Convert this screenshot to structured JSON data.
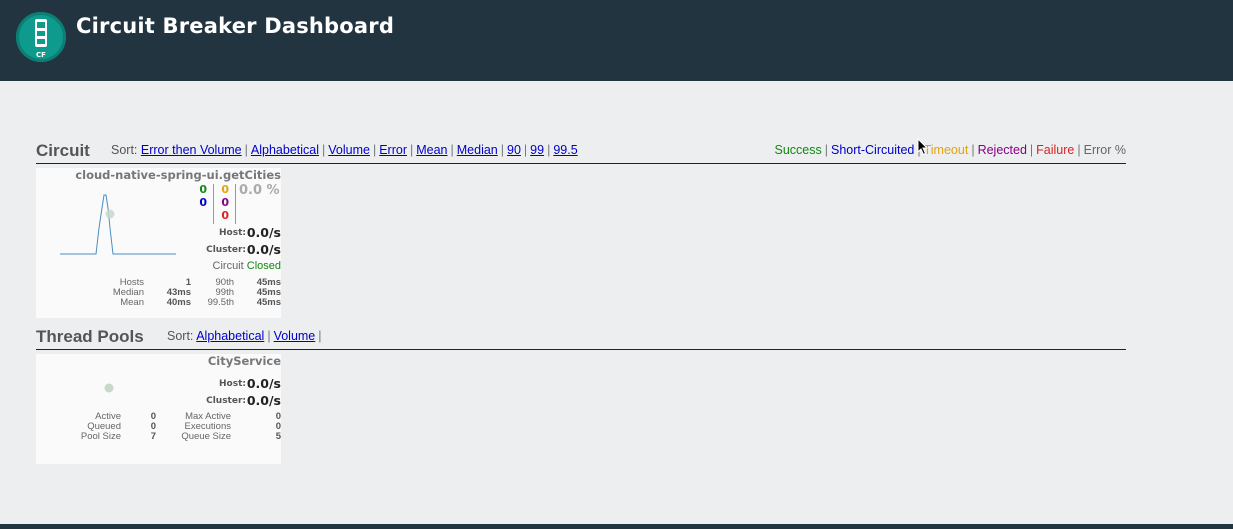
{
  "header": {
    "title": "Circuit Breaker Dashboard",
    "logo_text": "CF"
  },
  "circuit_section": {
    "title": "Circuit",
    "sort_label": "Sort:",
    "sort_options": [
      "Error then Volume",
      "Alphabetical",
      "Volume",
      "Error",
      "Mean",
      "Median",
      "90",
      "99",
      "99.5"
    ],
    "legend": [
      {
        "label": "Success",
        "color": "#118811"
      },
      {
        "label": "Short-Circuited",
        "color": "#0000cc"
      },
      {
        "label": "Timeout",
        "color": "#e8a30c"
      },
      {
        "label": "Rejected",
        "color": "#880088"
      },
      {
        "label": "Failure",
        "color": "#dd2222"
      },
      {
        "label": "Error %",
        "color": "#666666"
      }
    ]
  },
  "circuit_card": {
    "name": "cloud-native-spring-ui.getCities",
    "counts": {
      "success": "0",
      "short_circuited": "0",
      "timeout": "0",
      "rejected": "0",
      "failure": "0"
    },
    "error_pct": "0.0 %",
    "host_label": "Host:",
    "host_rate": "0.0/s",
    "cluster_label": "Cluster:",
    "cluster_rate": "0.0/s",
    "circuit_label": "Circuit",
    "circuit_status": "Closed",
    "stats": {
      "hosts_label": "Hosts",
      "hosts": "1",
      "median_label": "Median",
      "median": "43ms",
      "mean_label": "Mean",
      "mean": "40ms",
      "p90_label": "90th",
      "p90": "45ms",
      "p99_label": "99th",
      "p99": "45ms",
      "p995_label": "99.5th",
      "p995": "45ms"
    }
  },
  "thread_section": {
    "title": "Thread Pools",
    "sort_label": "Sort:",
    "sort_options": [
      "Alphabetical",
      "Volume"
    ]
  },
  "pool_card": {
    "name": "CityService",
    "host_label": "Host:",
    "host_rate": "0.0/s",
    "cluster_label": "Cluster:",
    "cluster_rate": "0.0/s",
    "stats": {
      "active_label": "Active",
      "active": "0",
      "queued_label": "Queued",
      "queued": "0",
      "pool_size_label": "Pool Size",
      "pool_size": "7",
      "max_active_label": "Max Active",
      "max_active": "0",
      "executions_label": "Executions",
      "executions": "0",
      "queue_size_label": "Queue Size",
      "queue_size": "5"
    }
  }
}
